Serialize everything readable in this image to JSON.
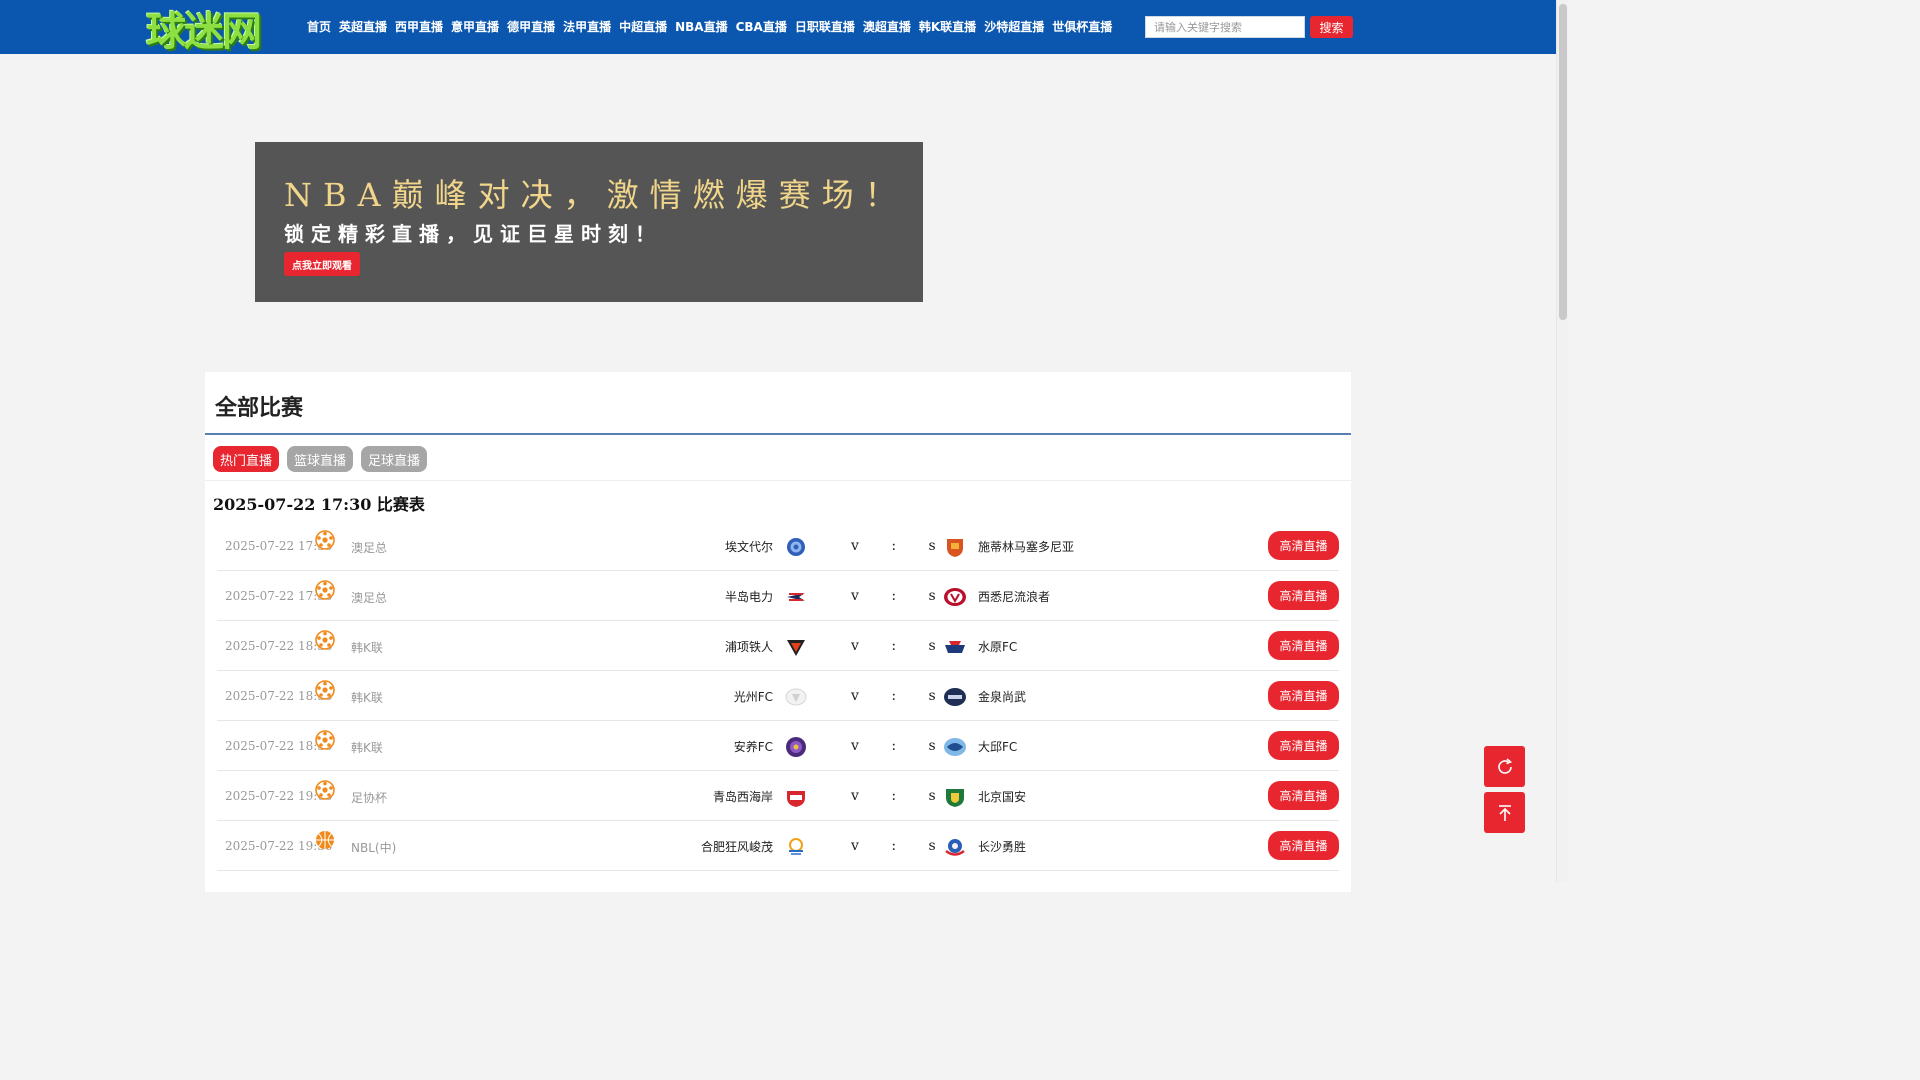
{
  "header": {
    "logo_text": "球迷网",
    "nav": [
      "首页",
      "英超直播",
      "西甲直播",
      "意甲直播",
      "德甲直播",
      "法甲直播",
      "中超直播",
      "NBA直播",
      "CBA直播",
      "日职联直播",
      "澳超直播",
      "韩K联直播",
      "沙特超直播",
      "世俱杯直播"
    ],
    "search_placeholder": "请输入关键字搜索",
    "search_label": "搜索"
  },
  "banner": {
    "line1": "NBA巅峰对决，激情燃爆赛场！",
    "line2": "锁定精彩直播，见证巨星时刻！",
    "button": "点我立即观看"
  },
  "main": {
    "title": "全部比赛",
    "tabs": [
      "热门直播",
      "篮球直播",
      "足球直播"
    ],
    "schedule_title": "2025-07-22 17:30 比赛表",
    "matches": [
      {
        "time": "2025-07-22 17:30",
        "sport": "soccer-ball-icon",
        "league": "澳足总",
        "home": "埃文代尔",
        "score": "v : s",
        "away": "施蒂林马塞多尼亚",
        "button": "高清直播"
      },
      {
        "time": "2025-07-22 17:30",
        "sport": "soccer-ball-icon",
        "league": "澳足总",
        "home": "半岛电力",
        "score": "v : s",
        "away": "西悉尼流浪者",
        "button": "高清直播"
      },
      {
        "time": "2025-07-22 18:30",
        "sport": "soccer-ball-icon",
        "league": "韩K联",
        "home": "浦项铁人",
        "score": "v : s",
        "away": "水原FC",
        "button": "高清直播"
      },
      {
        "time": "2025-07-22 18:30",
        "sport": "soccer-ball-icon",
        "league": "韩K联",
        "home": "光州FC",
        "score": "v : s",
        "away": "金泉尚武",
        "button": "高清直播"
      },
      {
        "time": "2025-07-22 18:30",
        "sport": "soccer-ball-icon",
        "league": "韩K联",
        "home": "安养FC",
        "score": "v : s",
        "away": "大邱FC",
        "button": "高清直播"
      },
      {
        "time": "2025-07-22 19:00",
        "sport": "soccer-ball-icon",
        "league": "足协杯",
        "home": "青岛西海岸",
        "score": "v : s",
        "away": "北京国安",
        "button": "高清直播"
      },
      {
        "time": "2025-07-22 19:30",
        "sport": "basketball-icon",
        "league": "NBL(中)",
        "home": "合肥狂风峻茂",
        "score": "v : s",
        "away": "长沙勇胜",
        "button": "高清直播"
      }
    ]
  },
  "colors": {
    "header_bg": "#0b57b0",
    "accent_red": "#e8262f",
    "tab_inactive": "#a6a6a6",
    "banner_bg": "#555555",
    "banner_gold": "#f0d58a"
  },
  "floating": [
    "refresh-icon",
    "back-to-top-icon"
  ]
}
